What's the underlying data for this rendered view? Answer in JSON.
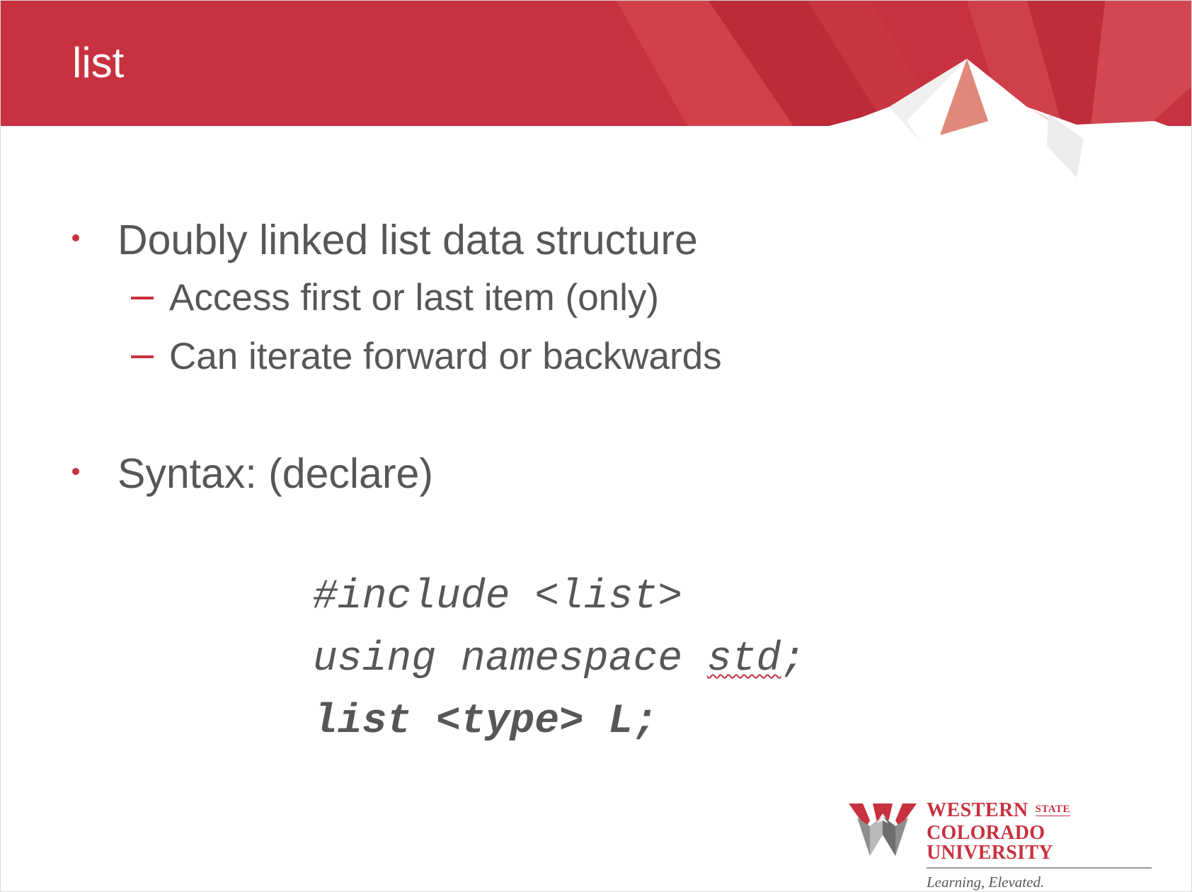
{
  "slide": {
    "title": "list",
    "bullets": [
      {
        "text": "Doubly linked list data structure",
        "subitems": [
          "Access first or last item (only)",
          "Can iterate forward or backwards"
        ]
      },
      {
        "text": "Syntax: (declare)",
        "subitems": []
      }
    ],
    "code": {
      "line1": "#include <list>",
      "line2_prefix": "using namespace ",
      "line2_word": "std",
      "line2_suffix": ";",
      "line3": "list <type> L;"
    }
  },
  "logo": {
    "line1": "WESTERN",
    "state": "STATE",
    "line2": "COLORADO UNIVERSITY",
    "tagline": "Learning, Elevated."
  },
  "colors": {
    "banner_red": "#c8313f",
    "text_gray": "#555759",
    "accent_red": "#c8313f"
  }
}
